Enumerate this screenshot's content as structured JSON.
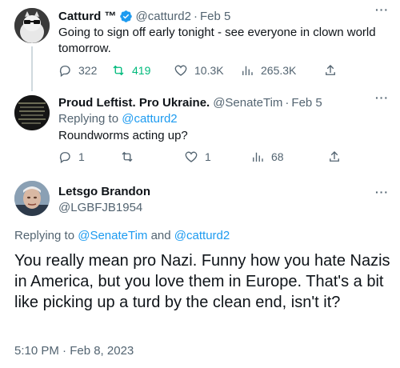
{
  "tweets": [
    {
      "name": "Catturd ™",
      "handle": "@catturd2",
      "date": "Feb 5",
      "text": "Going to sign off early tonight - see everyone in clown world tomorrow.",
      "replies": "322",
      "retweets": "419",
      "likes": "10.3K",
      "views": "265.3K"
    },
    {
      "name": "Proud Leftist. Pro Ukraine.",
      "handle": "@SenateTim",
      "date": "Feb 5",
      "replying_label": "Replying to",
      "replying_to": "@catturd2",
      "text": "Roundworms acting up?",
      "replies": "1",
      "retweets": "",
      "likes": "1",
      "views": "68"
    }
  ],
  "main": {
    "name": "Letsgo Brandon",
    "handle": "@LGBFJB1954",
    "replying_label": "Replying to",
    "replying_to_1": "@SenateTim",
    "and": "and",
    "replying_to_2": "@catturd2",
    "text": "You really mean pro Nazi. Funny how you hate Nazis in America, but you love them in Europe. That's a bit like picking up a turd by the clean end, isn't it?",
    "timestamp": "5:10 PM · Feb 8, 2023"
  },
  "more_label": "···",
  "colors": {
    "accent": "#1d9bf0",
    "retweet_active": "#00ba7c",
    "muted": "#536471"
  }
}
